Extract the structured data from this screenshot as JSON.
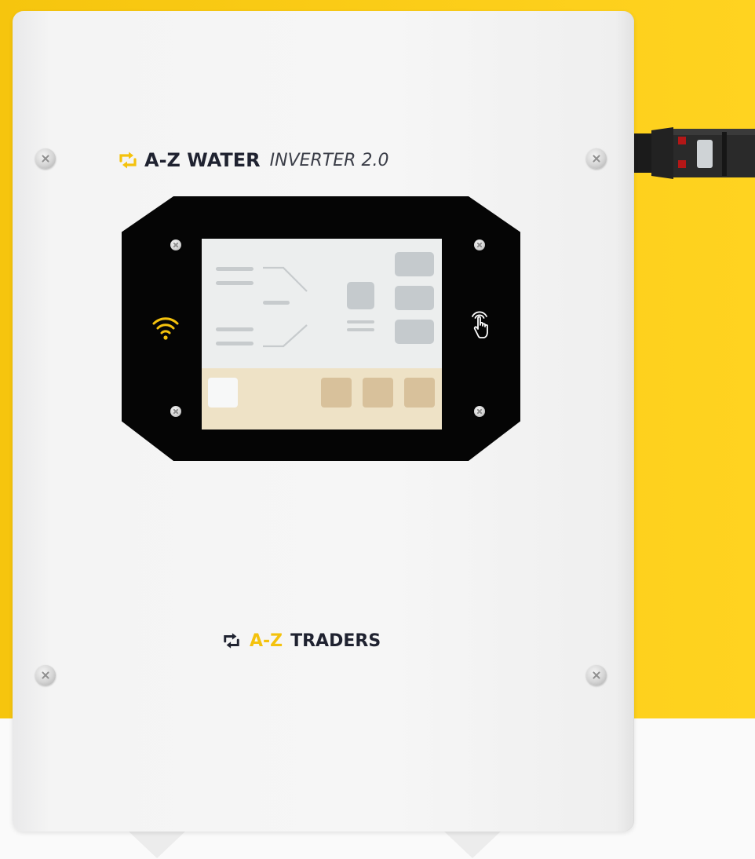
{
  "brand": {
    "product_name_bold": "A-Z WATER",
    "product_name_light": "INVERTER 2.0",
    "company_highlight": "A-Z",
    "company_rest": "TRADERS"
  },
  "icons": {
    "logo": "refresh-arrows-icon",
    "wifi": "wifi-icon",
    "touch": "touch-hand-icon",
    "screw": "screw-icon"
  },
  "colors": {
    "backdrop": "#f6c50e",
    "accent_yellow": "#f4c20d",
    "brand_dark": "#1f2230",
    "bezel": "#050505",
    "screen": "#eceeee",
    "screen_footer": "#eee2c6"
  }
}
